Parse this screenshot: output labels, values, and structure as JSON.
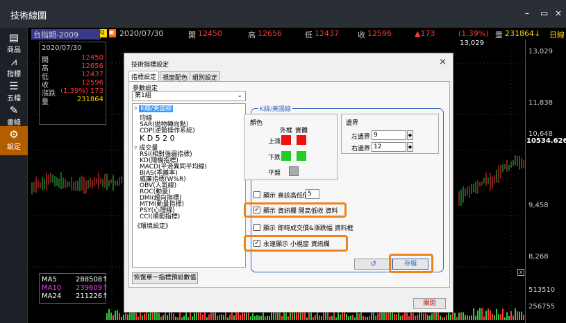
{
  "window": {
    "title": "技術線圖",
    "minimize": "–",
    "maximize": "▭",
    "close": "×"
  },
  "toolbar": [
    {
      "icon": "document-icon",
      "glyph": "▤",
      "label": "商品"
    },
    {
      "icon": "line-chart-icon",
      "glyph": "⩘",
      "label": "指標"
    },
    {
      "icon": "five-levels-icon",
      "glyph": "☰",
      "label": "五檔"
    },
    {
      "icon": "pencil-icon",
      "glyph": "✎",
      "label": "畫線"
    },
    {
      "icon": "gear-icon",
      "glyph": "⚙",
      "label": "設定"
    }
  ],
  "infobar": {
    "symbol": "台指期-2009",
    "date": "2020/07/30",
    "open_label": "開",
    "open": "12450",
    "high_label": "高",
    "high": "12656",
    "low_label": "低",
    "low": "12437",
    "close_label": "收",
    "close": "12596",
    "change": "▲173",
    "change_pct": "(1.39%)",
    "volume_label": "量",
    "volume": "231864↓",
    "period": "日線"
  },
  "quote_box": {
    "date": "2020/07/30",
    "rows": [
      {
        "label": "開",
        "value": "12450"
      },
      {
        "label": "高",
        "value": "12656"
      },
      {
        "label": "低",
        "value": "12437"
      },
      {
        "label": "收",
        "value": "12596"
      },
      {
        "label": "漲跌",
        "value": "(1.39%) 173"
      },
      {
        "label": "量",
        "value": "231864"
      }
    ]
  },
  "chart": {
    "top_price": "13,029",
    "axis": [
      "13,029",
      "11,838",
      "10,648",
      "10534.6264",
      "9,458",
      "8,268",
      "513510",
      "256755"
    ],
    "close_marker": "x"
  },
  "ma_box": [
    {
      "label": "MA5",
      "value": "288508↑",
      "color": "#ffffff"
    },
    {
      "label": "MA10",
      "value": "239609↑",
      "color": "#ff33ff"
    },
    {
      "label": "MA24",
      "value": "211226↑",
      "color": "#ffffff"
    }
  ],
  "dialog": {
    "title": "技術指標設定",
    "close": "×",
    "tabs": [
      "指標設定",
      "視窗配色",
      "組別設定"
    ],
    "param_label": "參數設定",
    "group_value": "第1組",
    "tree": [
      "K線/美國線",
      "均線",
      "SAR(拋物轉向點)",
      "CDP(逆勢操作系統)",
      "K D 5 2 0",
      "成交量",
      "RSI(相對強弱指標)",
      "KD(隨機指標)",
      "MACD(平滑異同平均線)",
      "BIAS(乖離率)",
      "威廉指標(W%R)",
      "OBV(人氣線)",
      "ROC(動量)",
      "DMI(趨向指標)",
      "MTM(動量指標)",
      "PSY(心理線)",
      "CCI(順勢指標)",
      "《環境設定》"
    ],
    "reset_button": "恢復單一指標預設數值",
    "group_title": "K線/美國線",
    "color_title": "顏色",
    "outer_frame": "外框",
    "solid_body": "實體",
    "rise": "上漲",
    "fall": "下跌",
    "flat": "平盤",
    "boundary_title": "邊界",
    "left_boundary": "左邊界",
    "left_value": "9",
    "right_boundary": "右邊界",
    "right_value": "12",
    "opt1": "顯示 喜該高低價",
    "opt1_value": "5",
    "opt2": "顯示 資訊欄 開高低收 資料",
    "opt3": "顯示 即時成交價&漲跌幅 資料框",
    "opt4": "永遠顯示 小視窗 資訊欄",
    "undo": "↺",
    "save": "存檔",
    "close_button": "關閉"
  }
}
